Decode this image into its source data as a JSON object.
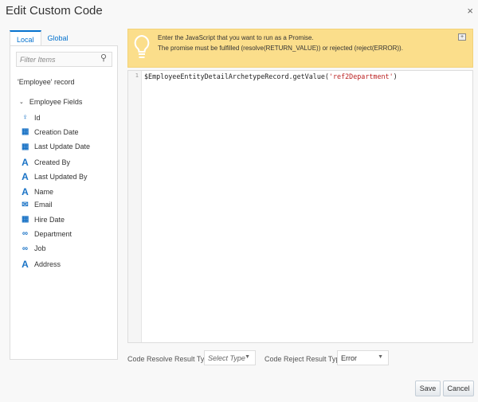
{
  "dialog": {
    "title": "Edit Custom Code",
    "close_icon": "×"
  },
  "tabs": [
    {
      "label": "Local",
      "active": true
    },
    {
      "label": "Global",
      "active": false
    }
  ],
  "filter": {
    "placeholder": "Filter Items"
  },
  "tree": {
    "record_label": "'Employee' record",
    "group_label": "Employee Fields",
    "fields": [
      {
        "label": "Id",
        "icon": "key-icon"
      },
      {
        "label": "Creation Date",
        "icon": "calendar-clock-icon"
      },
      {
        "label": "Last Update Date",
        "icon": "calendar-clock-icon"
      },
      {
        "label": "Created By",
        "icon": "text-icon"
      },
      {
        "label": "Last Updated By",
        "icon": "text-icon"
      },
      {
        "label": "Name",
        "icon": "text-icon"
      },
      {
        "label": "Email",
        "icon": "email-icon"
      },
      {
        "label": "Hire Date",
        "icon": "calendar-icon"
      },
      {
        "label": "Department",
        "icon": "link-icon"
      },
      {
        "label": "Job",
        "icon": "link-icon"
      },
      {
        "label": "Address",
        "icon": "text-icon"
      }
    ]
  },
  "banner": {
    "line1": "Enter the JavaScript that you want to run as a Promise.",
    "line2": "The promise must be fulfilled (resolve(RETURN_VALUE)) or rejected (reject(ERROR))."
  },
  "editor": {
    "line_number": "1",
    "code_prefix": "$EmployeeEntityDetailArchetypeRecord.getValue(",
    "code_string": "'ref2Department'",
    "code_suffix": ")"
  },
  "footer": {
    "resolve_label": "Code Resolve Result Type",
    "resolve_value": "Select Type",
    "reject_label": "Code Reject Result Type",
    "reject_value": "Error",
    "save": "Save",
    "cancel": "Cancel"
  },
  "colors": {
    "accent": "#0572ce",
    "banner": "#fbde8b"
  }
}
